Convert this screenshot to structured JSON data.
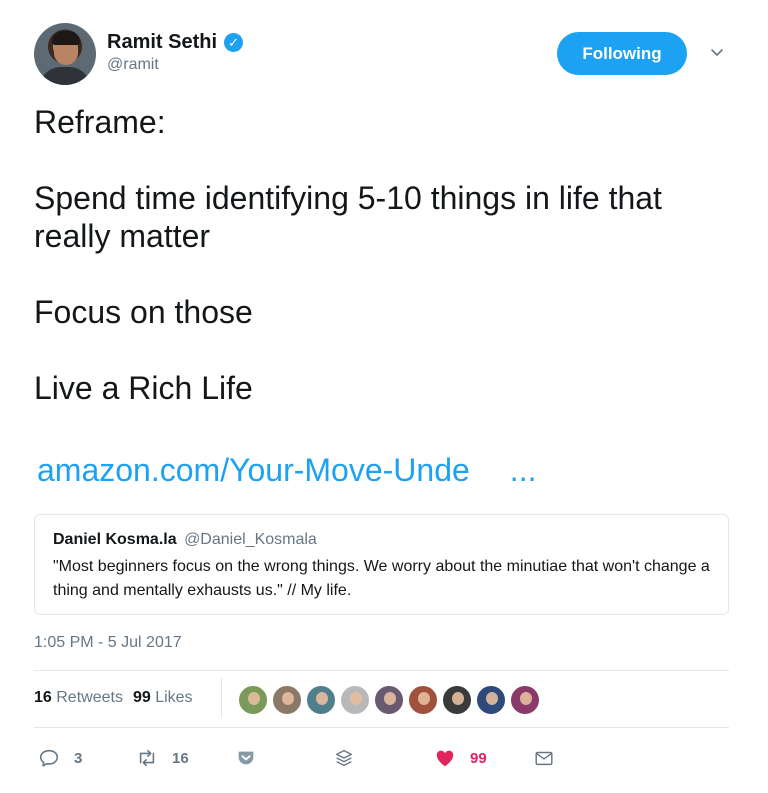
{
  "author": {
    "display_name": "Ramit Sethi",
    "handle": "@ramit",
    "verified_icon": "verified-badge-icon"
  },
  "header": {
    "follow_label": "Following",
    "menu_icon": "chevron-down-icon"
  },
  "tweet": {
    "lines": [
      "Reframe:",
      "Spend time identifying 5-10 things in life that really matter",
      "Focus on those",
      "Live a Rich Life"
    ],
    "link_text": "amazon.com/Your-Move-Unde",
    "link_ellipsis": "..."
  },
  "quote": {
    "name": "Daniel Kosma.la",
    "handle": "@Daniel_Kosmala",
    "text": "\"Most beginners focus on the wrong things. We worry about the minutiae that won't change a thing and mentally exhausts us.\" // My life."
  },
  "timestamp": "1:05 PM - 5 Jul 2017",
  "stats": {
    "retweets_count": "16",
    "retweets_label": "Retweets",
    "likes_count": "99",
    "likes_label": "Likes",
    "liker_avatars": [
      "#7a9a5a",
      "#8b7866",
      "#4f7f8a",
      "#b8b8b8",
      "#6a5a70",
      "#a0523d",
      "#3a3a3a",
      "#2d4a7a",
      "#8a3a6a"
    ]
  },
  "actions": {
    "reply_count": "3",
    "retweet_count": "16",
    "like_count": "99",
    "colors": {
      "accent": "#1da1f2",
      "like": "#e0245e",
      "muted": "#657786"
    }
  }
}
